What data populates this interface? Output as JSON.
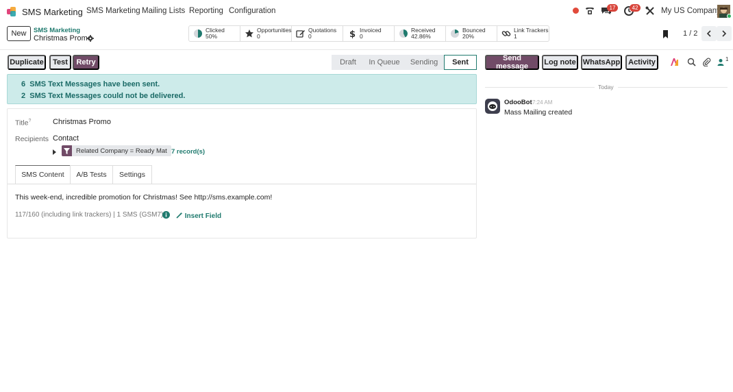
{
  "topnav": {
    "app_name": "SMS Marketing",
    "menus": [
      "SMS Marketing",
      "Mailing Lists",
      "Reporting",
      "Configuration"
    ],
    "messages_badge": "17",
    "activities_badge": "42",
    "company": "My US Company"
  },
  "control": {
    "new_label": "New",
    "breadcrumb_parent": "SMS Marketing",
    "breadcrumb_current": "Christmas Promo",
    "pager": "1 / 2"
  },
  "stats": [
    {
      "label": "Clicked",
      "value": "50%",
      "icon": "pie-half-icon",
      "fill": 0.5
    },
    {
      "label": "Opportunities",
      "value": "0",
      "icon": "star-icon"
    },
    {
      "label": "Quotations",
      "value": "0",
      "icon": "pencil-square-icon"
    },
    {
      "label": "Invoiced",
      "value": "0",
      "icon": "dollar-icon"
    },
    {
      "label": "Received",
      "value": "42.86%",
      "icon": "pie-icon",
      "fill": 0.4286
    },
    {
      "label": "Bounced",
      "value": "20%",
      "icon": "pie-small-icon",
      "fill": 0.2
    },
    {
      "label": "Link Trackers",
      "value": "1",
      "icon": "link-icon"
    }
  ],
  "actions": {
    "duplicate": "Duplicate",
    "test": "Test",
    "retry": "Retry"
  },
  "stages": [
    "Draft",
    "In Queue",
    "Sending",
    "Sent"
  ],
  "current_stage": "Sent",
  "alert": {
    "sent_count": "6",
    "sent_text": "SMS Text Messages have been sent.",
    "failed_count": "2",
    "failed_text": "SMS Text Messages could not be delivered."
  },
  "form": {
    "title_label": "Title",
    "title_help": "?",
    "title_value": "Christmas Promo",
    "recipients_label": "Recipients",
    "recipients_value": "Contact",
    "filter": "Related Company = Ready Mat",
    "records": "7 record(s)"
  },
  "tabs": [
    "SMS Content",
    "A/B Tests",
    "Settings"
  ],
  "sms": {
    "body": "This week-end, incredible promotion for Christmas! See http://sms.example.com!",
    "count": "117/160  (including link trackers) | 1 SMS (GSM7)",
    "insert_field": "Insert Field"
  },
  "chatter": {
    "send_message": "Send message",
    "log_note": "Log note",
    "whatsapp": "WhatsApp",
    "activity": "Activity",
    "followers": "1",
    "date_sep": "Today",
    "author": "OdooBot",
    "time": "7:24 AM",
    "message": "Mass Mailing created"
  }
}
